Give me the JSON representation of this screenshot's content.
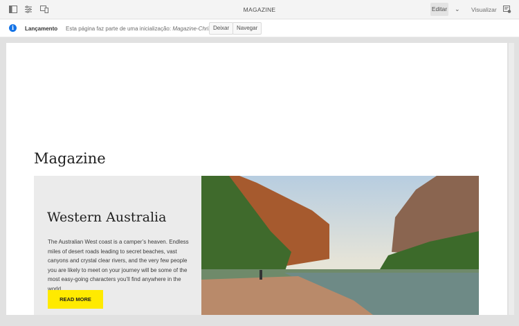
{
  "topbar": {
    "title": "MAGAZINE",
    "edit_label": "Editar",
    "preview_label": "Visualizar",
    "icons": [
      "side-panel-icon",
      "properties-icon",
      "emulator-icon",
      "chevron-down-icon",
      "page-info-icon"
    ]
  },
  "launch": {
    "label": "Lançamento",
    "message": "Esta página faz parte de uma inicialização: ",
    "launch_name": "Magazine-Christmas",
    "leave_label": "Deixar",
    "navigate_label": "Navegar"
  },
  "page": {
    "heading": "Magazine",
    "card": {
      "title": "Western Australia",
      "text": "The Australian West coast is a camper’s heaven. Endless miles of desert roads leading to secret beaches, vast canyons and crystal clear rivers, and the very few people you are likely to meet on your journey will be some of the most easy-going characters you’ll find anywhere in the world.",
      "button": "READ MORE",
      "button_color": "#ffea00"
    }
  }
}
